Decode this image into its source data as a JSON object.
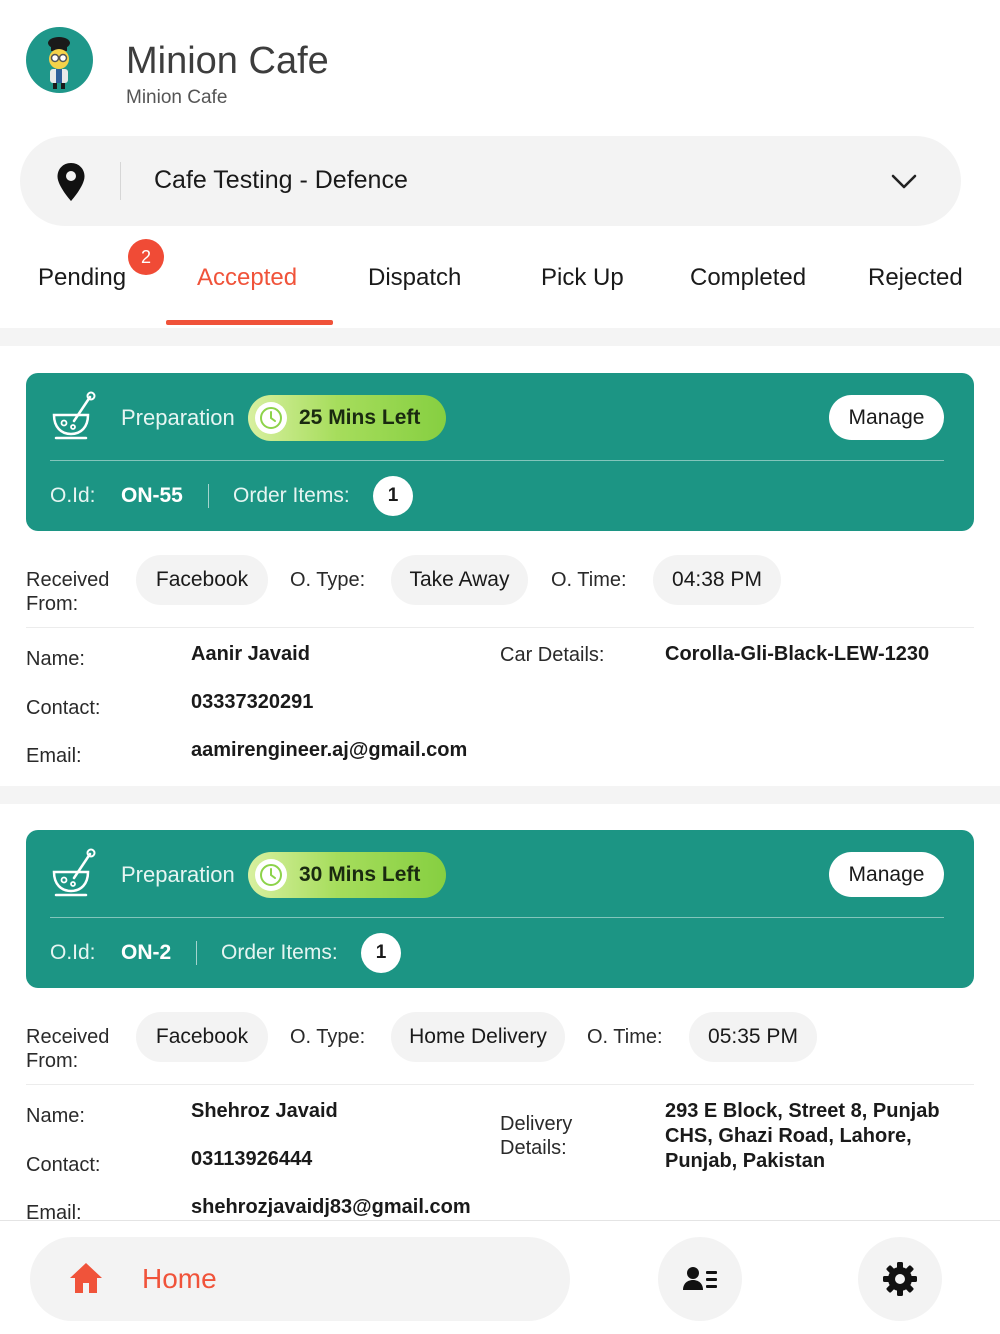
{
  "header": {
    "title": "Minion Cafe",
    "subtitle": "Minion Cafe"
  },
  "location": {
    "selected": "Cafe Testing - Defence"
  },
  "tabs": [
    {
      "label": "Pending",
      "badge": "2",
      "active": false
    },
    {
      "label": "Accepted",
      "active": true
    },
    {
      "label": "Dispatch",
      "active": false
    },
    {
      "label": "Pick Up",
      "active": false
    },
    {
      "label": "Completed",
      "active": false
    },
    {
      "label": "Rejected",
      "active": false
    }
  ],
  "colors": {
    "accent": "#f0533a",
    "card": "#1c9584",
    "timer": "#8dd34a"
  },
  "labels": {
    "preparation": "Preparation",
    "manage": "Manage",
    "oid": "O.Id:",
    "order_items": "Order Items:",
    "received_from": "Received From:",
    "o_type": "O. Type:",
    "o_time": "O. Time:",
    "name": "Name:",
    "contact": "Contact:",
    "email": "Email:",
    "car_details": "Car Details:",
    "delivery_details": "Delivery Details:"
  },
  "orders": [
    {
      "time_left": "25 Mins Left",
      "id": "ON-55",
      "items": "1",
      "source": "Facebook",
      "type": "Take Away",
      "time": "04:38 PM",
      "name": "Aanir Javaid",
      "contact": "03337320291",
      "email": "aamirengineer.aj@gmail.com",
      "car_details": "Corolla-Gli-Black-LEW-1230"
    },
    {
      "time_left": "30 Mins Left",
      "id": "ON-2",
      "items": "1",
      "source": "Facebook",
      "type": "Home Delivery",
      "time": "05:35 PM",
      "name": "Shehroz Javaid",
      "contact": "03113926444",
      "email": "shehrozjavaidj83@gmail.com",
      "delivery_details": "293 E Block, Street 8, Punjab CHS, Ghazi Road, Lahore, Punjab, Pakistan"
    }
  ],
  "bottom_nav": {
    "home_label": "Home"
  },
  "icons": [
    "chef-logo-icon",
    "location-pin-icon",
    "chevron-down-icon",
    "mixing-bowl-icon",
    "clock-icon",
    "home-icon",
    "contacts-icon",
    "gear-icon"
  ]
}
